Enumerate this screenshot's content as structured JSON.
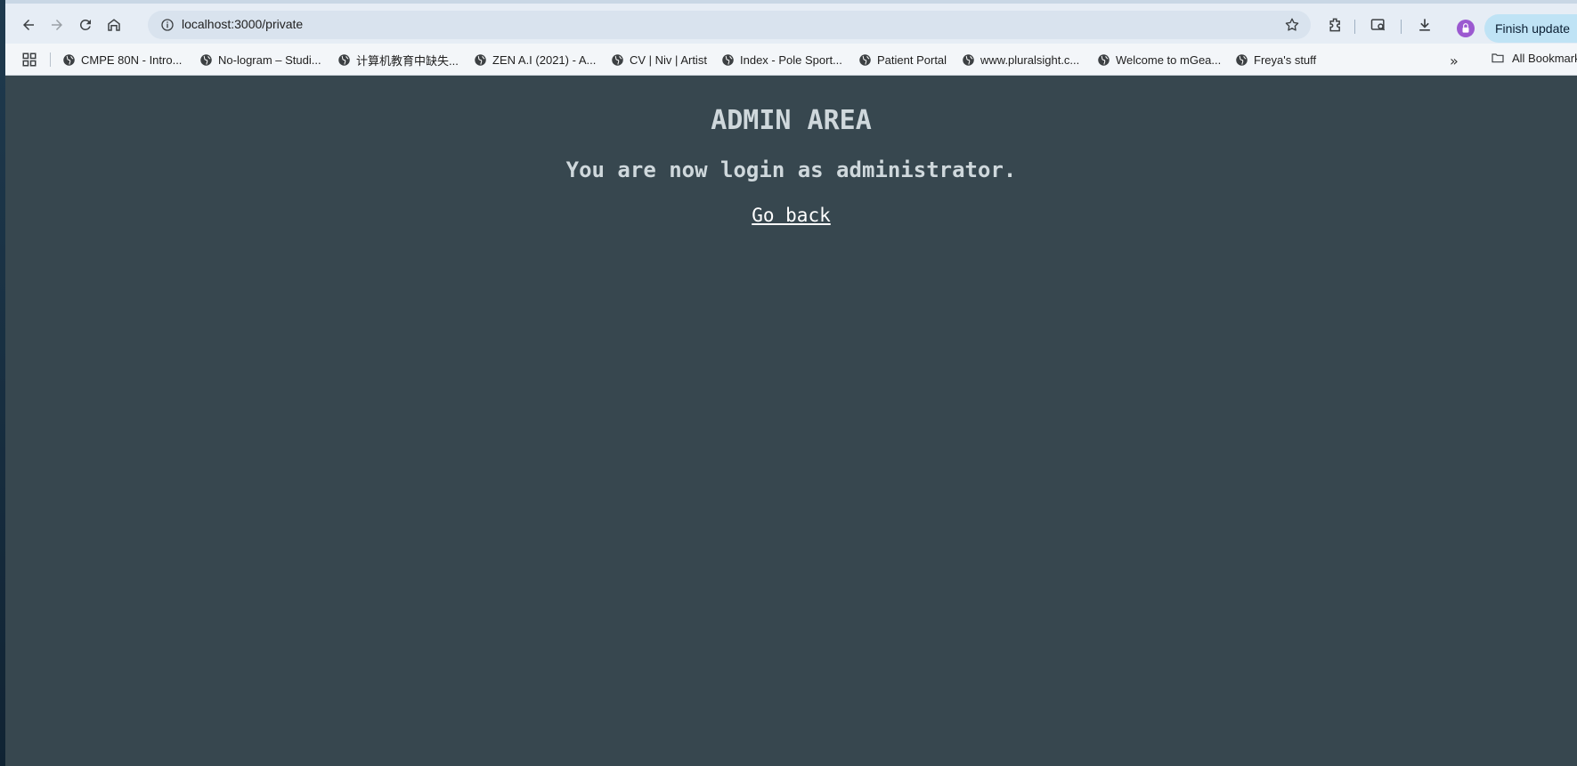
{
  "browser": {
    "url": "localhost:3000/private",
    "finish_update_label": "Finish update",
    "bookmarks": [
      {
        "label": "CMPE 80N - Intro..."
      },
      {
        "label": "No-logram – Studi..."
      },
      {
        "label": "计算机教育中缺失..."
      },
      {
        "label": "ZEN A.I (2021) - A..."
      },
      {
        "label": "CV | Niv | Artist"
      },
      {
        "label": "Index - Pole Sport..."
      },
      {
        "label": "Patient Portal"
      },
      {
        "label": "www.pluralsight.c..."
      },
      {
        "label": "Welcome to mGea..."
      },
      {
        "label": "Freya's stuff"
      }
    ],
    "more_bookmarks_glyph": "»",
    "all_bookmarks_label": "All Bookmarks"
  },
  "page": {
    "title": "ADMIN AREA",
    "subtitle": "You are now login as administrator.",
    "go_back_label": "Go back"
  },
  "colors": {
    "page_background": "#37474f",
    "heading_text": "#cfd8dc",
    "link_text": "#ffffff",
    "finish_update_button": "#bfe3f5",
    "profile_avatar": "#9b59d0"
  },
  "icons": [
    "back-icon",
    "forward-icon",
    "reload-icon",
    "home-icon",
    "site-info-icon",
    "bookmark-star-icon",
    "extensions-icon",
    "tab-search-icon",
    "downloads-icon",
    "profile-avatar-icon",
    "menu-icon",
    "apps-icon",
    "globe-icon",
    "chevron-double-right-icon",
    "folder-icon"
  ]
}
